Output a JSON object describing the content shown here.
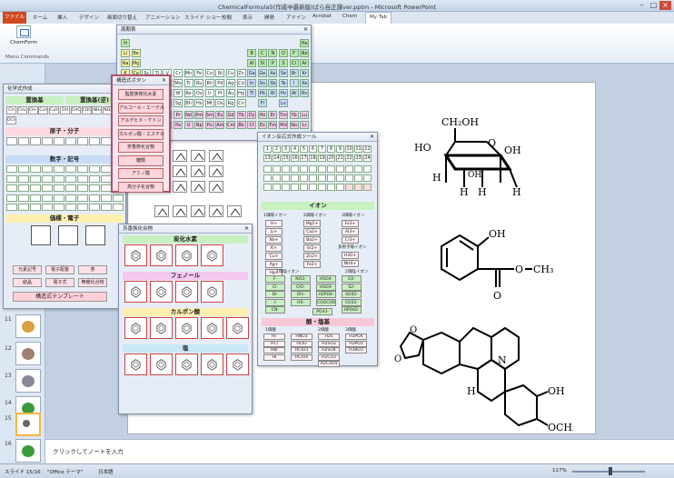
{
  "window": {
    "title": "ChemicalFormula5(作成中最新版)ばら自正課ver.pptm - Microsoft PowerPoint"
  },
  "ribbon": {
    "file": "ファイル",
    "tabs": [
      "ホーム",
      "挿入",
      "デザイン",
      "画面切り替え",
      "アニメーション",
      "スライド ショー",
      "校閲",
      "表示",
      "開発",
      "アドイン",
      "Acrobat",
      "Chem",
      "My Tab"
    ],
    "chemform": "ChemForm",
    "menu_commands": "Menu Commands"
  },
  "slides": {
    "numbers": [
      "11",
      "12",
      "13",
      "14",
      "15",
      "16"
    ]
  },
  "notes": {
    "placeholder": "クリックしてノートを入力"
  },
  "status": {
    "slide": "スライド 15/16",
    "theme": "\"Office テーマ\"",
    "lang": "日本語",
    "zoom": "117%"
  },
  "periodic": {
    "title": "周期表",
    "rows": [
      [
        "H",
        "",
        "",
        "",
        "",
        "",
        "",
        "",
        "",
        "",
        "",
        "",
        "",
        "",
        "",
        "",
        "",
        "He"
      ],
      [
        "Li",
        "Be",
        "",
        "",
        "",
        "",
        "",
        "",
        "",
        "",
        "",
        "",
        "B",
        "C",
        "N",
        "O",
        "F",
        "Ne"
      ],
      [
        "Na",
        "Mg",
        "",
        "",
        "",
        "",
        "",
        "",
        "",
        "",
        "",
        "",
        "Al",
        "Si",
        "P",
        "S",
        "Cl",
        "Ar"
      ],
      [
        "K",
        "Ca",
        "Sc",
        "Ti",
        "V",
        "Cr",
        "Mn",
        "Fe",
        "Co",
        "Ni",
        "Cu",
        "Zn",
        "Ga",
        "Ge",
        "As",
        "Se",
        "Br",
        "Kr"
      ],
      [
        "Rb",
        "Sr",
        "Y",
        "Zr",
        "Nb",
        "Mo",
        "Tc",
        "Ru",
        "Rh",
        "Pd",
        "Ag",
        "Cd",
        "In",
        "Sn",
        "Sb",
        "Te",
        "I",
        "Xe"
      ],
      [
        "Cs",
        "Ba",
        "",
        "Hf",
        "Ta",
        "W",
        "Re",
        "Os",
        "Ir",
        "Pt",
        "Au",
        "Hg",
        "Tl",
        "Pb",
        "Bi",
        "Po",
        "At",
        "Rn"
      ],
      [
        "Fr",
        "Ra",
        "",
        "Rf",
        "Db",
        "Sg",
        "Bh",
        "Hs",
        "Mt",
        "Ds",
        "Rg",
        "Cn",
        "",
        "Fl",
        "",
        "Lv",
        "",
        ""
      ],
      [
        "",
        "",
        "",
        "La",
        "Ce",
        "Pr",
        "Nd",
        "Pm",
        "Sm",
        "Eu",
        "Gd",
        "Tb",
        "Dy",
        "Ho",
        "Er",
        "Tm",
        "Yb",
        "Lu"
      ],
      [
        "",
        "",
        "",
        "Ac",
        "Th",
        "Pa",
        "U",
        "Np",
        "Pu",
        "Am",
        "Cm",
        "Bk",
        "Cf",
        "Es",
        "Fm",
        "Md",
        "No",
        "Lr"
      ]
    ]
  },
  "structural": {
    "title": "構造式ボタン",
    "items": [
      "脂肪族炭化水素",
      "アルコール・エーテル",
      "アルデヒド・ケトン",
      "カルボン酸・エステル",
      "芳香族化合物",
      "糖類",
      "アミノ酸",
      "高分子化合物"
    ]
  },
  "chemformula": {
    "title": "化学式作成",
    "sections": {
      "sub": "置換基",
      "sub2": "置換基(逆)",
      "atom": "原子・分子",
      "num": "数字・記号",
      "bond": "価標・電子"
    },
    "atoms": [
      "CH",
      "CH₂",
      "CH₃",
      "C₂H₅",
      "C₆H₅",
      "OH",
      "CHO",
      "COOH",
      "NH₂",
      "NO₂",
      "SO₃H",
      "OCH₃"
    ],
    "bottom": [
      "元素記号",
      "電子配置",
      "茶",
      "結晶",
      "電子式",
      "無機化合物"
    ],
    "template": "構造式テンプレート"
  },
  "ionic": {
    "title": "イオン反応式作成ツール",
    "section_ion": "イオン",
    "section_salt": "酸・塩基",
    "nums": [
      "1",
      "2",
      "3",
      "4",
      "5",
      "6",
      "7",
      "8",
      "9",
      "10",
      "11",
      "12",
      "13",
      "14",
      "15",
      "16",
      "17",
      "18",
      "19",
      "20",
      "21",
      "22",
      "23",
      "24"
    ],
    "cations": {
      "h1": "1価陽イオン",
      "h2": "2価陽イオン",
      "h3": "3価陽イオン",
      "rows": [
        [
          "H+",
          "Mg2+",
          "Fe3+"
        ],
        [
          "Li+",
          "Ca2+",
          "Al3+"
        ],
        [
          "Na+",
          "Ba2+",
          "Cr3+"
        ],
        [
          "K+",
          "Sr2+",
          ""
        ],
        [
          "Cu+",
          "Zn2+",
          ""
        ],
        [
          "Ag+",
          "Fe2+",
          ""
        ],
        [
          "Hg+",
          "",
          ""
        ]
      ]
    },
    "multi": "多原子陽イオン",
    "multi_ions": [
      "H3O+",
      "NH4+"
    ],
    "anions": {
      "h1": "1価陰イオン",
      "h2": "2価陰イオン",
      "rows": [
        [
          "F-",
          "NO3-",
          "HSO4-",
          "O2-"
        ],
        [
          "Cl-",
          "ClO-",
          "HSO3-",
          "S2-"
        ],
        [
          "Br-",
          "OH-",
          "H2PO4-",
          "SO42-"
        ],
        [
          "I-",
          "HS-",
          "COOCOO-",
          "CO32-"
        ],
        [
          "CN-",
          "",
          "",
          "HPO42-"
        ]
      ],
      "extra": "PO43-"
    },
    "acids": {
      "h1": "1価酸",
      "h2": "2価酸",
      "h3": "3価酸",
      "rows": [
        [
          "HF",
          "HNO3",
          "H2S",
          "H3PO4"
        ],
        [
          "HCl",
          "HClO",
          "H2SO3",
          "H3PO3"
        ],
        [
          "HBr",
          "HClO3",
          "H2SO4",
          "H3BO3"
        ],
        [
          "HI",
          "HClO4",
          "H2CO3",
          ""
        ],
        [
          "",
          "",
          "H2C2O4",
          ""
        ]
      ]
    }
  },
  "aromatic": {
    "title": "芳香族化合物",
    "sections": [
      "炭化水素",
      "フェノール",
      "カルボン酸",
      "塩"
    ]
  },
  "slide_molecules": {
    "glucose_top": "CH₂OH",
    "m2_oh": "OH",
    "m2_ch3": "CH₃",
    "m3_oh": "OH",
    "m3_och3": "OCH₃",
    "n": "N",
    "h": "H",
    "ring_h": [
      "H",
      "H",
      "H",
      "H",
      "H"
    ],
    "ring_oh": [
      "HO",
      "OH",
      "OH"
    ],
    "o": "O"
  }
}
